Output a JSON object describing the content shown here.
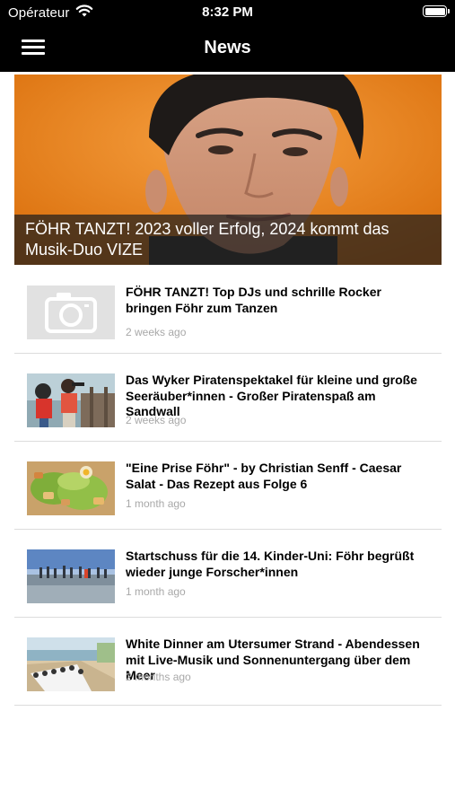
{
  "status_bar": {
    "carrier": "Opérateur",
    "time": "8:32 PM"
  },
  "nav": {
    "title": "News",
    "menu_icon": "hamburger-menu-icon"
  },
  "featured": {
    "title": "FÖHR TANZT! 2023 voller Erfolg, 2024 kommt das Musik-Duo VIZE"
  },
  "articles": [
    {
      "title": "FÖHR TANZT! Top DJs und schrille Rocker bringen Föhr zum Tanzen",
      "time": "2 weeks ago",
      "thumb": "camera-placeholder-icon"
    },
    {
      "title": "Das Wyker Piratenspektakel für kleine und große Seeräuber*innen - Großer Piratenspaß am Sandwall",
      "time": "2 weeks ago",
      "thumb": "pirate-kids-photo"
    },
    {
      "title": "\"Eine Prise Föhr\" - by Christian Senff - Caesar Salat - Das Rezept aus Folge 6",
      "time": "1 month ago",
      "thumb": "caesar-salad-photo"
    },
    {
      "title": "Startschuss für die 14. Kinder-Uni: Föhr begrüßt wieder junge Forscher*innen",
      "time": "1 month ago",
      "thumb": "mudflat-group-photo"
    },
    {
      "title": "White Dinner am Utersumer Strand - Abendessen mit Live-Musik und Sonnenuntergang über dem Meer",
      "time": "2 months ago",
      "thumb": "beach-dinner-photo"
    }
  ],
  "colors": {
    "app_bar": "#000000",
    "hero_background": "#e47d13",
    "divider": "#dcdcdc",
    "timestamp": "#a8a8a8"
  }
}
